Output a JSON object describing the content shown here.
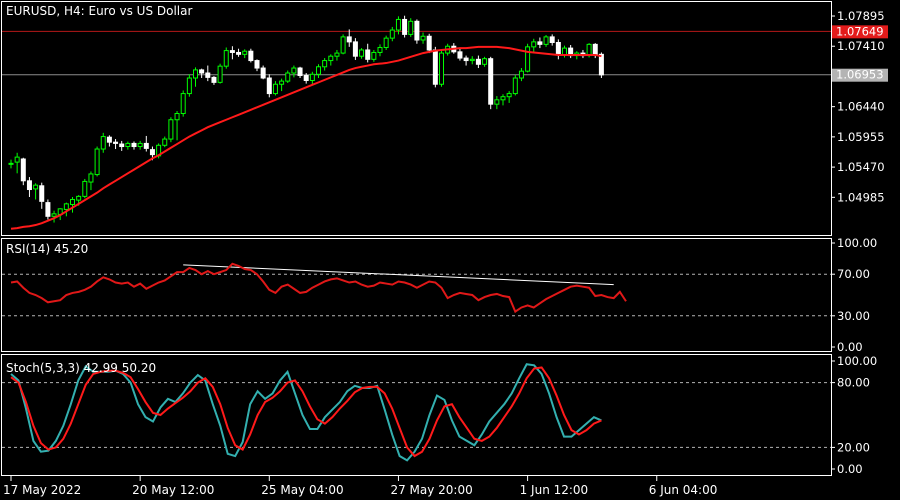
{
  "window": {
    "symbol": "EURUSD",
    "timeframe": "H4",
    "description": "Euro vs US Dollar",
    "title_text": "EURUSD, H4:  Euro vs US Dollar"
  },
  "colors": {
    "background": "#000000",
    "frame": "#ffffff",
    "bull": "#00ff00",
    "bear": "#ffffff",
    "ma": "#ff1a1a",
    "rsi": "#e01818",
    "stoch_main": "#33b0b0",
    "stoch_signal": "#ff1a1a",
    "hline_red": "#b41818",
    "hline_gray": "#8c8c8c",
    "level_dash": "#b4b4b4",
    "tag_red": "#e31b1b",
    "tag_gray": "#b4b4b4"
  },
  "chart_data": {
    "type": "candlestick",
    "price_axis": {
      "ticks": [
        1.07895,
        1.0741,
        1.0644,
        1.05955,
        1.0547,
        1.04985
      ],
      "tick_labels": [
        "1.07895",
        "1.07410",
        "1.06440",
        "1.05955",
        "1.05470",
        "1.04985"
      ],
      "ylim": [
        1.0438,
        1.0812
      ]
    },
    "price_tags": [
      {
        "label": "1.07649",
        "value": 1.07649,
        "kind": "red"
      },
      {
        "label": "1.06953",
        "value": 1.06953,
        "kind": "gray"
      }
    ],
    "hlines": [
      {
        "value": 1.07649,
        "kind": "red"
      },
      {
        "value": 1.06953,
        "kind": "gray"
      }
    ],
    "time_axis": {
      "labels": [
        "17 May 2022",
        "20 May 12:00",
        "25 May 04:00",
        "27 May 20:00",
        "1 Jun 12:00",
        "6 Jun 04:00"
      ],
      "label_bars": [
        0,
        21,
        42,
        63,
        84,
        105
      ]
    },
    "candles": [
      [
        1.0552,
        1.0559,
        1.0545,
        1.0553
      ],
      [
        1.0555,
        1.057,
        1.0537,
        1.0563
      ],
      [
        1.056,
        1.0562,
        1.0518,
        1.0525
      ],
      [
        1.0525,
        1.0531,
        1.0499,
        1.0511
      ],
      [
        1.0512,
        1.0521,
        1.0495,
        1.0518
      ],
      [
        1.0517,
        1.0522,
        1.048,
        1.0492
      ],
      [
        1.049,
        1.0495,
        1.0463,
        1.0468
      ],
      [
        1.0468,
        1.0477,
        1.0458,
        1.0472
      ],
      [
        1.0471,
        1.0481,
        1.0462,
        1.048
      ],
      [
        1.0479,
        1.049,
        1.0468,
        1.0488
      ],
      [
        1.0487,
        1.0499,
        1.0474,
        1.0495
      ],
      [
        1.0494,
        1.0502,
        1.0485,
        1.05
      ],
      [
        1.05,
        1.0528,
        1.0497,
        1.0524
      ],
      [
        1.0523,
        1.054,
        1.051,
        1.0536
      ],
      [
        1.0535,
        1.058,
        1.0532,
        1.0576
      ],
      [
        1.0576,
        1.0602,
        1.057,
        1.0596
      ],
      [
        1.0595,
        1.0598,
        1.058,
        1.0587
      ],
      [
        1.0587,
        1.0592,
        1.0576,
        1.0585
      ],
      [
        1.0584,
        1.0589,
        1.0573,
        1.058
      ],
      [
        1.058,
        1.0588,
        1.0575,
        1.0585
      ],
      [
        1.0585,
        1.0588,
        1.0575,
        1.058
      ],
      [
        1.058,
        1.0589,
        1.0575,
        1.0585
      ],
      [
        1.0585,
        1.0597,
        1.0572,
        1.0577
      ],
      [
        1.0575,
        1.058,
        1.0558,
        1.0567
      ],
      [
        1.0565,
        1.0585,
        1.0561,
        1.0582
      ],
      [
        1.0582,
        1.0596,
        1.0579,
        1.0592
      ],
      [
        1.0592,
        1.0627,
        1.0587,
        1.0623
      ],
      [
        1.0623,
        1.0637,
        1.059,
        1.0633
      ],
      [
        1.0633,
        1.067,
        1.0628,
        1.0665
      ],
      [
        1.0665,
        1.0696,
        1.066,
        1.069
      ],
      [
        1.069,
        1.0707,
        1.0676,
        1.0703
      ],
      [
        1.0703,
        1.0705,
        1.069,
        1.0698
      ],
      [
        1.0698,
        1.071,
        1.0685,
        1.0691
      ],
      [
        1.0691,
        1.0693,
        1.0679,
        1.0683
      ],
      [
        1.0683,
        1.0713,
        1.0681,
        1.0709
      ],
      [
        1.0709,
        1.0739,
        1.0705,
        1.0734
      ],
      [
        1.0734,
        1.0741,
        1.072,
        1.0731
      ],
      [
        1.0731,
        1.0737,
        1.0724,
        1.0728
      ],
      [
        1.0728,
        1.0736,
        1.0722,
        1.0733
      ],
      [
        1.0733,
        1.0737,
        1.0715,
        1.0718
      ],
      [
        1.0718,
        1.072,
        1.0701,
        1.0706
      ],
      [
        1.0706,
        1.071,
        1.0688,
        1.069
      ],
      [
        1.069,
        1.0696,
        1.0659,
        1.0665
      ],
      [
        1.0665,
        1.0685,
        1.0662,
        1.068
      ],
      [
        1.068,
        1.0689,
        1.0669,
        1.0685
      ],
      [
        1.0685,
        1.0702,
        1.0682,
        1.0698
      ],
      [
        1.0698,
        1.071,
        1.0691,
        1.0706
      ],
      [
        1.0706,
        1.0708,
        1.069,
        1.0694
      ],
      [
        1.0694,
        1.0698,
        1.0681,
        1.0686
      ],
      [
        1.0686,
        1.07,
        1.0679,
        1.0696
      ],
      [
        1.0696,
        1.0712,
        1.069,
        1.0708
      ],
      [
        1.0708,
        1.0722,
        1.0702,
        1.0718
      ],
      [
        1.0718,
        1.0728,
        1.071,
        1.0725
      ],
      [
        1.0725,
        1.0735,
        1.0718,
        1.073
      ],
      [
        1.073,
        1.076,
        1.0728,
        1.0756
      ],
      [
        1.0756,
        1.0768,
        1.074,
        1.0748
      ],
      [
        1.0748,
        1.0754,
        1.0719,
        1.0725
      ],
      [
        1.0725,
        1.0738,
        1.0721,
        1.0735
      ],
      [
        1.0735,
        1.0745,
        1.0715,
        1.072
      ],
      [
        1.072,
        1.0735,
        1.0716,
        1.0731
      ],
      [
        1.0731,
        1.0744,
        1.0725,
        1.0739
      ],
      [
        1.0739,
        1.0758,
        1.0735,
        1.0754
      ],
      [
        1.0754,
        1.0772,
        1.0749,
        1.0767
      ],
      [
        1.0767,
        1.0789,
        1.076,
        1.0784
      ],
      [
        1.0784,
        1.079,
        1.0755,
        1.076
      ],
      [
        1.076,
        1.0786,
        1.0756,
        1.0781
      ],
      [
        1.0781,
        1.0784,
        1.0745,
        1.0751
      ],
      [
        1.0751,
        1.0763,
        1.0745,
        1.0757
      ],
      [
        1.0757,
        1.0761,
        1.073,
        1.0735
      ],
      [
        1.0735,
        1.074,
        1.0675,
        1.068
      ],
      [
        1.068,
        1.0735,
        1.0676,
        1.073
      ],
      [
        1.073,
        1.0745,
        1.0726,
        1.0741
      ],
      [
        1.0741,
        1.0746,
        1.0729,
        1.0732
      ],
      [
        1.0732,
        1.0738,
        1.0718,
        1.0722
      ],
      [
        1.0722,
        1.0726,
        1.071,
        1.0718
      ],
      [
        1.0718,
        1.0725,
        1.0712,
        1.072
      ],
      [
        1.072,
        1.0726,
        1.0706,
        1.0712
      ],
      [
        1.0712,
        1.0724,
        1.0708,
        1.0721
      ],
      [
        1.0721,
        1.0724,
        1.064,
        1.0648
      ],
      [
        1.0648,
        1.0661,
        1.064,
        1.0655
      ],
      [
        1.0655,
        1.0664,
        1.0646,
        1.066
      ],
      [
        1.066,
        1.0669,
        1.065,
        1.0665
      ],
      [
        1.0665,
        1.0695,
        1.0662,
        1.069
      ],
      [
        1.069,
        1.0706,
        1.0685,
        1.0701
      ],
      [
        1.0701,
        1.0745,
        1.0699,
        1.074
      ],
      [
        1.074,
        1.0753,
        1.073,
        1.0748
      ],
      [
        1.0748,
        1.0755,
        1.0738,
        1.0744
      ],
      [
        1.0744,
        1.0759,
        1.074,
        1.0756
      ],
      [
        1.0756,
        1.076,
        1.0742,
        1.0747
      ],
      [
        1.0747,
        1.0752,
        1.072,
        1.0727
      ],
      [
        1.0727,
        1.0742,
        1.0723,
        1.0738
      ],
      [
        1.0738,
        1.0743,
        1.0722,
        1.0726
      ],
      [
        1.0726,
        1.0733,
        1.072,
        1.073
      ],
      [
        1.073,
        1.0735,
        1.0722,
        1.0726
      ],
      [
        1.0726,
        1.0746,
        1.0723,
        1.0744
      ],
      [
        1.0744,
        1.0746,
        1.0722,
        1.0728
      ],
      [
        1.0728,
        1.0731,
        1.069,
        1.0695
      ]
    ],
    "ma": [
      1.0448,
      1.0449,
      1.0451,
      1.0452,
      1.0454,
      1.0457,
      1.0461,
      1.0465,
      1.047,
      1.0476,
      1.0482,
      1.0488,
      1.0494,
      1.05,
      1.0506,
      1.0513,
      1.0519,
      1.0525,
      1.0531,
      1.0537,
      1.0543,
      1.0549,
      1.0555,
      1.0561,
      1.0566,
      1.0572,
      1.0578,
      1.0584,
      1.059,
      1.0596,
      1.0601,
      1.0606,
      1.0611,
      1.0615,
      1.0619,
      1.0623,
      1.0627,
      1.0631,
      1.0635,
      1.0639,
      1.0643,
      1.0647,
      1.0651,
      1.0655,
      1.0659,
      1.0663,
      1.0667,
      1.0671,
      1.0675,
      1.0679,
      1.0683,
      1.0687,
      1.0691,
      1.0695,
      1.0699,
      1.0703,
      1.0706,
      1.0708,
      1.071,
      1.0712,
      1.0713,
      1.0714,
      1.0716,
      1.0718,
      1.0721,
      1.0724,
      1.0727,
      1.073,
      1.0732,
      1.0734,
      1.0735,
      1.0736,
      1.0737,
      1.0738,
      1.0738,
      1.0739,
      1.074,
      1.074,
      1.074,
      1.074,
      1.0739,
      1.0738,
      1.0736,
      1.0734,
      1.0732,
      1.0731,
      1.073,
      1.0729,
      1.0728,
      1.0727,
      1.0727,
      1.0727,
      1.0727,
      1.0727,
      1.0727,
      1.0727,
      1.0725
    ],
    "rsi": {
      "label": "RSI(14) 45.20",
      "axis_ticks": [
        100,
        70,
        30,
        0
      ],
      "tick_labels": [
        "100.00",
        "70.00",
        "30.00",
        "0.00"
      ],
      "levels": [
        70,
        30
      ],
      "values": [
        62,
        63,
        57,
        52,
        50,
        47,
        43,
        44,
        45,
        50,
        52,
        53,
        55,
        58,
        63,
        67,
        65,
        62,
        61,
        62,
        58,
        61,
        56,
        59,
        62,
        64,
        68,
        72,
        72,
        76,
        74,
        70,
        73,
        70,
        72,
        74,
        80,
        78,
        75,
        74,
        70,
        63,
        55,
        52,
        58,
        60,
        56,
        52,
        53,
        57,
        60,
        63,
        65,
        66,
        64,
        62,
        63,
        60,
        58,
        59,
        62,
        61,
        60,
        63,
        62,
        60,
        57,
        60,
        63,
        62,
        57,
        47,
        50,
        52,
        51,
        50,
        45,
        48,
        50,
        51,
        49,
        48,
        34,
        38,
        40,
        38,
        42,
        46,
        49,
        52,
        55,
        58,
        59,
        58,
        57,
        49,
        50,
        48,
        47,
        53,
        44
      ],
      "trendline": [
        [
          28,
          79
        ],
        [
          98,
          60
        ]
      ]
    },
    "stoch": {
      "label": "Stoch(5,3,3) 42.99 50.20",
      "axis_ticks": [
        100,
        80,
        20,
        0
      ],
      "tick_labels": [
        "100.00",
        "80.00",
        "20.00",
        "0.00"
      ],
      "levels": [
        80,
        20
      ],
      "main": [
        88,
        82,
        56,
        26,
        16,
        17,
        26,
        40,
        60,
        82,
        95,
        90,
        90,
        90,
        91,
        88,
        80,
        60,
        48,
        44,
        57,
        65,
        62,
        70,
        80,
        87,
        82,
        60,
        40,
        14,
        12,
        25,
        60,
        72,
        65,
        70,
        82,
        90,
        70,
        50,
        37,
        37,
        48,
        55,
        62,
        72,
        77,
        75,
        75,
        77,
        55,
        32,
        12,
        8,
        16,
        28,
        50,
        68,
        64,
        45,
        30,
        26,
        22,
        32,
        44,
        52,
        60,
        70,
        84,
        97,
        96,
        88,
        70,
        48,
        30,
        30,
        36,
        42,
        48,
        45
      ],
      "signal": [
        85,
        80,
        62,
        40,
        24,
        18,
        20,
        28,
        42,
        60,
        78,
        88,
        90,
        91,
        91,
        89,
        85,
        74,
        62,
        52,
        50,
        56,
        61,
        66,
        72,
        80,
        84,
        76,
        60,
        38,
        22,
        18,
        32,
        50,
        62,
        66,
        72,
        80,
        82,
        72,
        58,
        46,
        42,
        48,
        56,
        63,
        71,
        75,
        76,
        76,
        70,
        56,
        38,
        20,
        12,
        16,
        28,
        45,
        58,
        60,
        48,
        38,
        28,
        26,
        30,
        38,
        48,
        58,
        70,
        84,
        93,
        94,
        84,
        68,
        50,
        36,
        32,
        36,
        42,
        45
      ]
    }
  }
}
